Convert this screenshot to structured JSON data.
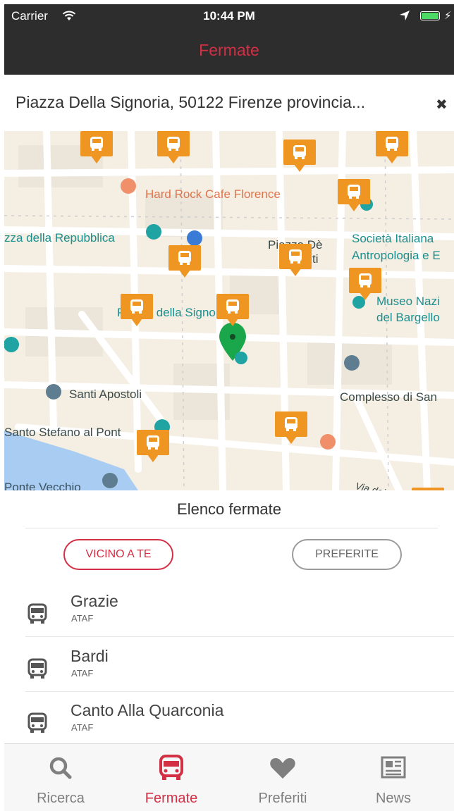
{
  "status_bar": {
    "carrier": "Carrier",
    "time": "10:44 PM"
  },
  "nav": {
    "title": "Fermate"
  },
  "address": {
    "text": "Piazza Della Signoria, 50122 Firenze provincia..."
  },
  "map": {
    "labels": {
      "hard_rock": "Hard Rock Cafe Florence",
      "repubblica": "zza della Repubblica",
      "piazza_de": "Piazza Dè",
      "piazza_de2": "ti",
      "societa": "Società Italiana",
      "antropologia": "Antropologia e E",
      "museo": "Museo Nazi",
      "bargello": "del Bargello",
      "signoria": "Piazza della Signoria",
      "santi_apostoli": "Santi Apostoli",
      "complesso": "Complesso di San",
      "santo_stefano": "Santo Stefano al Pont",
      "ponte_vecchio": "Ponte Vecchio",
      "via": "Via dei"
    }
  },
  "list": {
    "title": "Elenco fermate",
    "filters": {
      "nearby": "VICINO A TE",
      "favorites": "PREFERITE"
    },
    "stops": [
      {
        "name": "Grazie",
        "agency": "ATAF"
      },
      {
        "name": "Bardi",
        "agency": "ATAF"
      },
      {
        "name": "Canto Alla Quarconia",
        "agency": "ATAF"
      }
    ]
  },
  "tabs": [
    {
      "label": "Ricerca",
      "icon": "search-icon",
      "active": false
    },
    {
      "label": "Fermate",
      "icon": "bus-icon",
      "active": true
    },
    {
      "label": "Preferiti",
      "icon": "heart-icon",
      "active": false
    },
    {
      "label": "News",
      "icon": "newspaper-icon",
      "active": false
    }
  ],
  "colors": {
    "accent": "#d32f45",
    "bus_marker": "#ee9522",
    "bar": "#2d2d2d",
    "pin": "#1aa64b"
  }
}
